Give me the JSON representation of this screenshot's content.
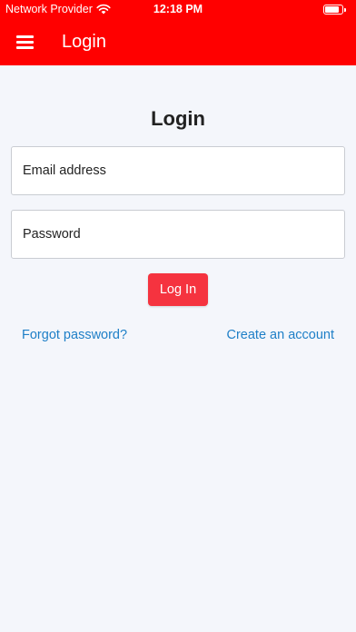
{
  "status_bar": {
    "carrier": "Network Provider",
    "time": "12:18 PM",
    "wifi_icon": "wifi-icon",
    "battery_icon": "battery-icon"
  },
  "header": {
    "title": "Login",
    "menu_icon": "hamburger-menu-icon",
    "background_color": "#ff0000"
  },
  "form": {
    "heading": "Login",
    "email": {
      "value": "",
      "placeholder": "Email address"
    },
    "password": {
      "value": "",
      "placeholder": "Password"
    },
    "submit_label": "Log In",
    "submit_color": "#f5333f"
  },
  "links": {
    "forgot_password": "Forgot password?",
    "create_account": "Create an account",
    "link_color": "#1e7fc7"
  }
}
